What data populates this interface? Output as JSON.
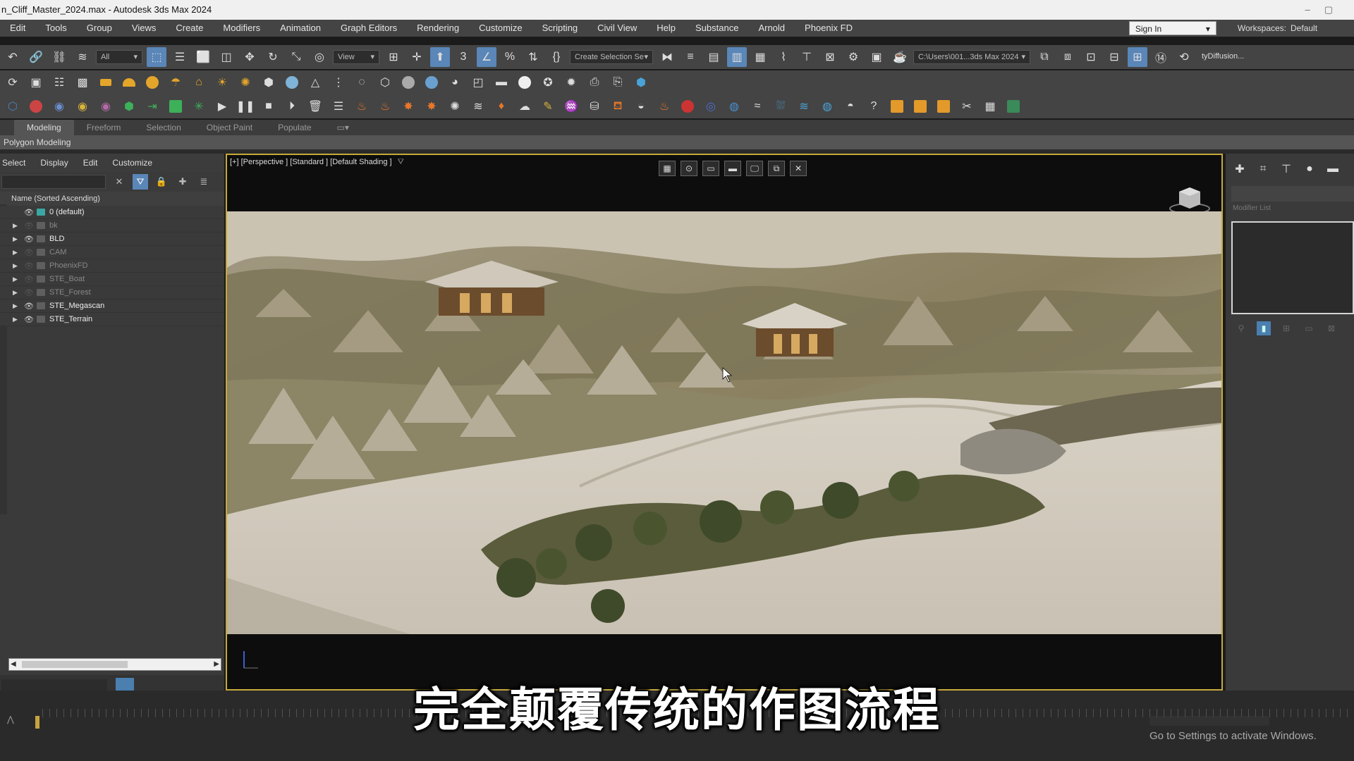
{
  "window": {
    "title": "n_Cliff_Master_2024.max - Autodesk 3ds Max 2024"
  },
  "menu": [
    "Edit",
    "Tools",
    "Group",
    "Views",
    "Create",
    "Modifiers",
    "Animation",
    "Graph Editors",
    "Rendering",
    "Customize",
    "Scripting",
    "Civil View",
    "Help",
    "Substance",
    "Arnold",
    "Phoenix FD"
  ],
  "account": {
    "sign_in": "Sign In",
    "workspaces_label": "Workspaces:",
    "workspace": "Default"
  },
  "toolbar": {
    "selection_filter": "All",
    "ref_coord": "View",
    "named_selection": "Create Selection Se",
    "project_path": "C:\\Users\\001...3ds Max 2024",
    "plugin_label": "tyDiffusion..."
  },
  "ribbon": {
    "tabs": [
      "Modeling",
      "Freeform",
      "Selection",
      "Object Paint",
      "Populate"
    ],
    "sub_label": "Polygon Modeling"
  },
  "scene_explorer": {
    "menu": [
      "Select",
      "Display",
      "Edit",
      "Customize"
    ],
    "column_header": "Name (Sorted Ascending)",
    "layers": [
      {
        "name": "0 (default)",
        "visible": true,
        "current": true
      },
      {
        "name": "bk",
        "visible": false
      },
      {
        "name": "BLD",
        "visible": true
      },
      {
        "name": "CAM",
        "visible": false
      },
      {
        "name": "PhoenixFD",
        "visible": false
      },
      {
        "name": "STE_Boat",
        "visible": false
      },
      {
        "name": "STE_Forest",
        "visible": false
      },
      {
        "name": "STE_Megascan",
        "visible": true
      },
      {
        "name": "STE_Terrain",
        "visible": true
      }
    ]
  },
  "viewport": {
    "label": "[+] [Perspective ] [Standard ] [Default Shading ]"
  },
  "command_panel": {
    "modifier_list_label": "Modifier List"
  },
  "subtitle": "完全颠覆传统的作图流程",
  "watermark": "Go to Settings to activate Windows.",
  "colors": {
    "viewport_border": "#c7a93b",
    "active_blue": "#5a86b8",
    "current_layer": "#3ba6a3"
  }
}
